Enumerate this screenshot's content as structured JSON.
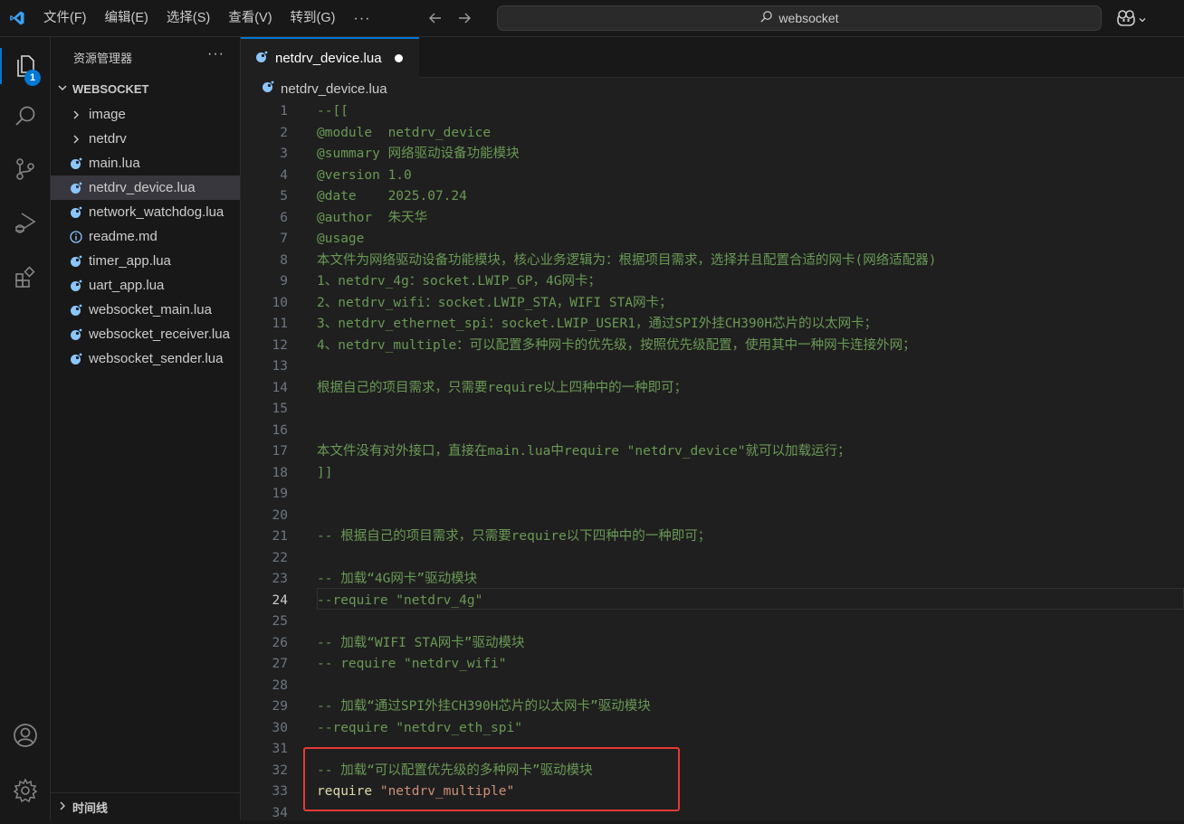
{
  "menu": [
    "文件(F)",
    "编辑(E)",
    "选择(S)",
    "查看(V)",
    "转到(G)"
  ],
  "menu_more": "···",
  "search": {
    "text": "websocket"
  },
  "activity": {
    "explorer_badge": "1"
  },
  "sidebar": {
    "title": "资源管理器",
    "more": "···",
    "root": "WEBSOCKET",
    "items": [
      {
        "label": "image",
        "type": "folder"
      },
      {
        "label": "netdrv",
        "type": "folder"
      },
      {
        "label": "main.lua",
        "type": "lua"
      },
      {
        "label": "netdrv_device.lua",
        "type": "lua",
        "selected": true
      },
      {
        "label": "network_watchdog.lua",
        "type": "lua"
      },
      {
        "label": "readme.md",
        "type": "md"
      },
      {
        "label": "timer_app.lua",
        "type": "lua"
      },
      {
        "label": "uart_app.lua",
        "type": "lua"
      },
      {
        "label": "websocket_main.lua",
        "type": "lua"
      },
      {
        "label": "websocket_receiver.lua",
        "type": "lua"
      },
      {
        "label": "websocket_sender.lua",
        "type": "lua"
      }
    ],
    "timeline": "时间线"
  },
  "editor": {
    "tab": "netdrv_device.lua",
    "breadcrumb": "netdrv_device.lua",
    "current_line": 24,
    "lines": [
      "--[[",
      "@module  netdrv_device",
      "@summary 网络驱动设备功能模块",
      "@version 1.0",
      "@date    2025.07.24",
      "@author  朱天华",
      "@usage",
      "本文件为网络驱动设备功能模块，核心业务逻辑为：根据项目需求，选择并且配置合适的网卡(网络适配器)",
      "1、netdrv_4g：socket.LWIP_GP，4G网卡；",
      "2、netdrv_wifi：socket.LWIP_STA，WIFI STA网卡；",
      "3、netdrv_ethernet_spi：socket.LWIP_USER1，通过SPI外挂CH390H芯片的以太网卡；",
      "4、netdrv_multiple：可以配置多种网卡的优先级，按照优先级配置，使用其中一种网卡连接外网；",
      "",
      "根据自己的项目需求，只需要require以上四种中的一种即可；",
      "",
      "",
      "本文件没有对外接口，直接在main.lua中require \"netdrv_device\"就可以加载运行；",
      "]]",
      "",
      "",
      "-- 根据自己的项目需求，只需要require以下四种中的一种即可；",
      "",
      "-- 加载“4G网卡”驱动模块",
      "--require \"netdrv_4g\"",
      "",
      "-- 加载“WIFI STA网卡”驱动模块",
      "-- require \"netdrv_wifi\"",
      "",
      "-- 加载“通过SPI外挂CH390H芯片的以太网卡”驱动模块",
      "--require \"netdrv_eth_spi\"",
      "",
      "-- 加载“可以配置优先级的多种网卡”驱动模块",
      "",
      ""
    ],
    "active_require": {
      "keyword": "require",
      "module": "\"netdrv_multiple\""
    }
  },
  "colors": {
    "accent": "#0078d4",
    "comment": "#6a9955",
    "string": "#ce9178",
    "highlight_box": "#e53935"
  }
}
